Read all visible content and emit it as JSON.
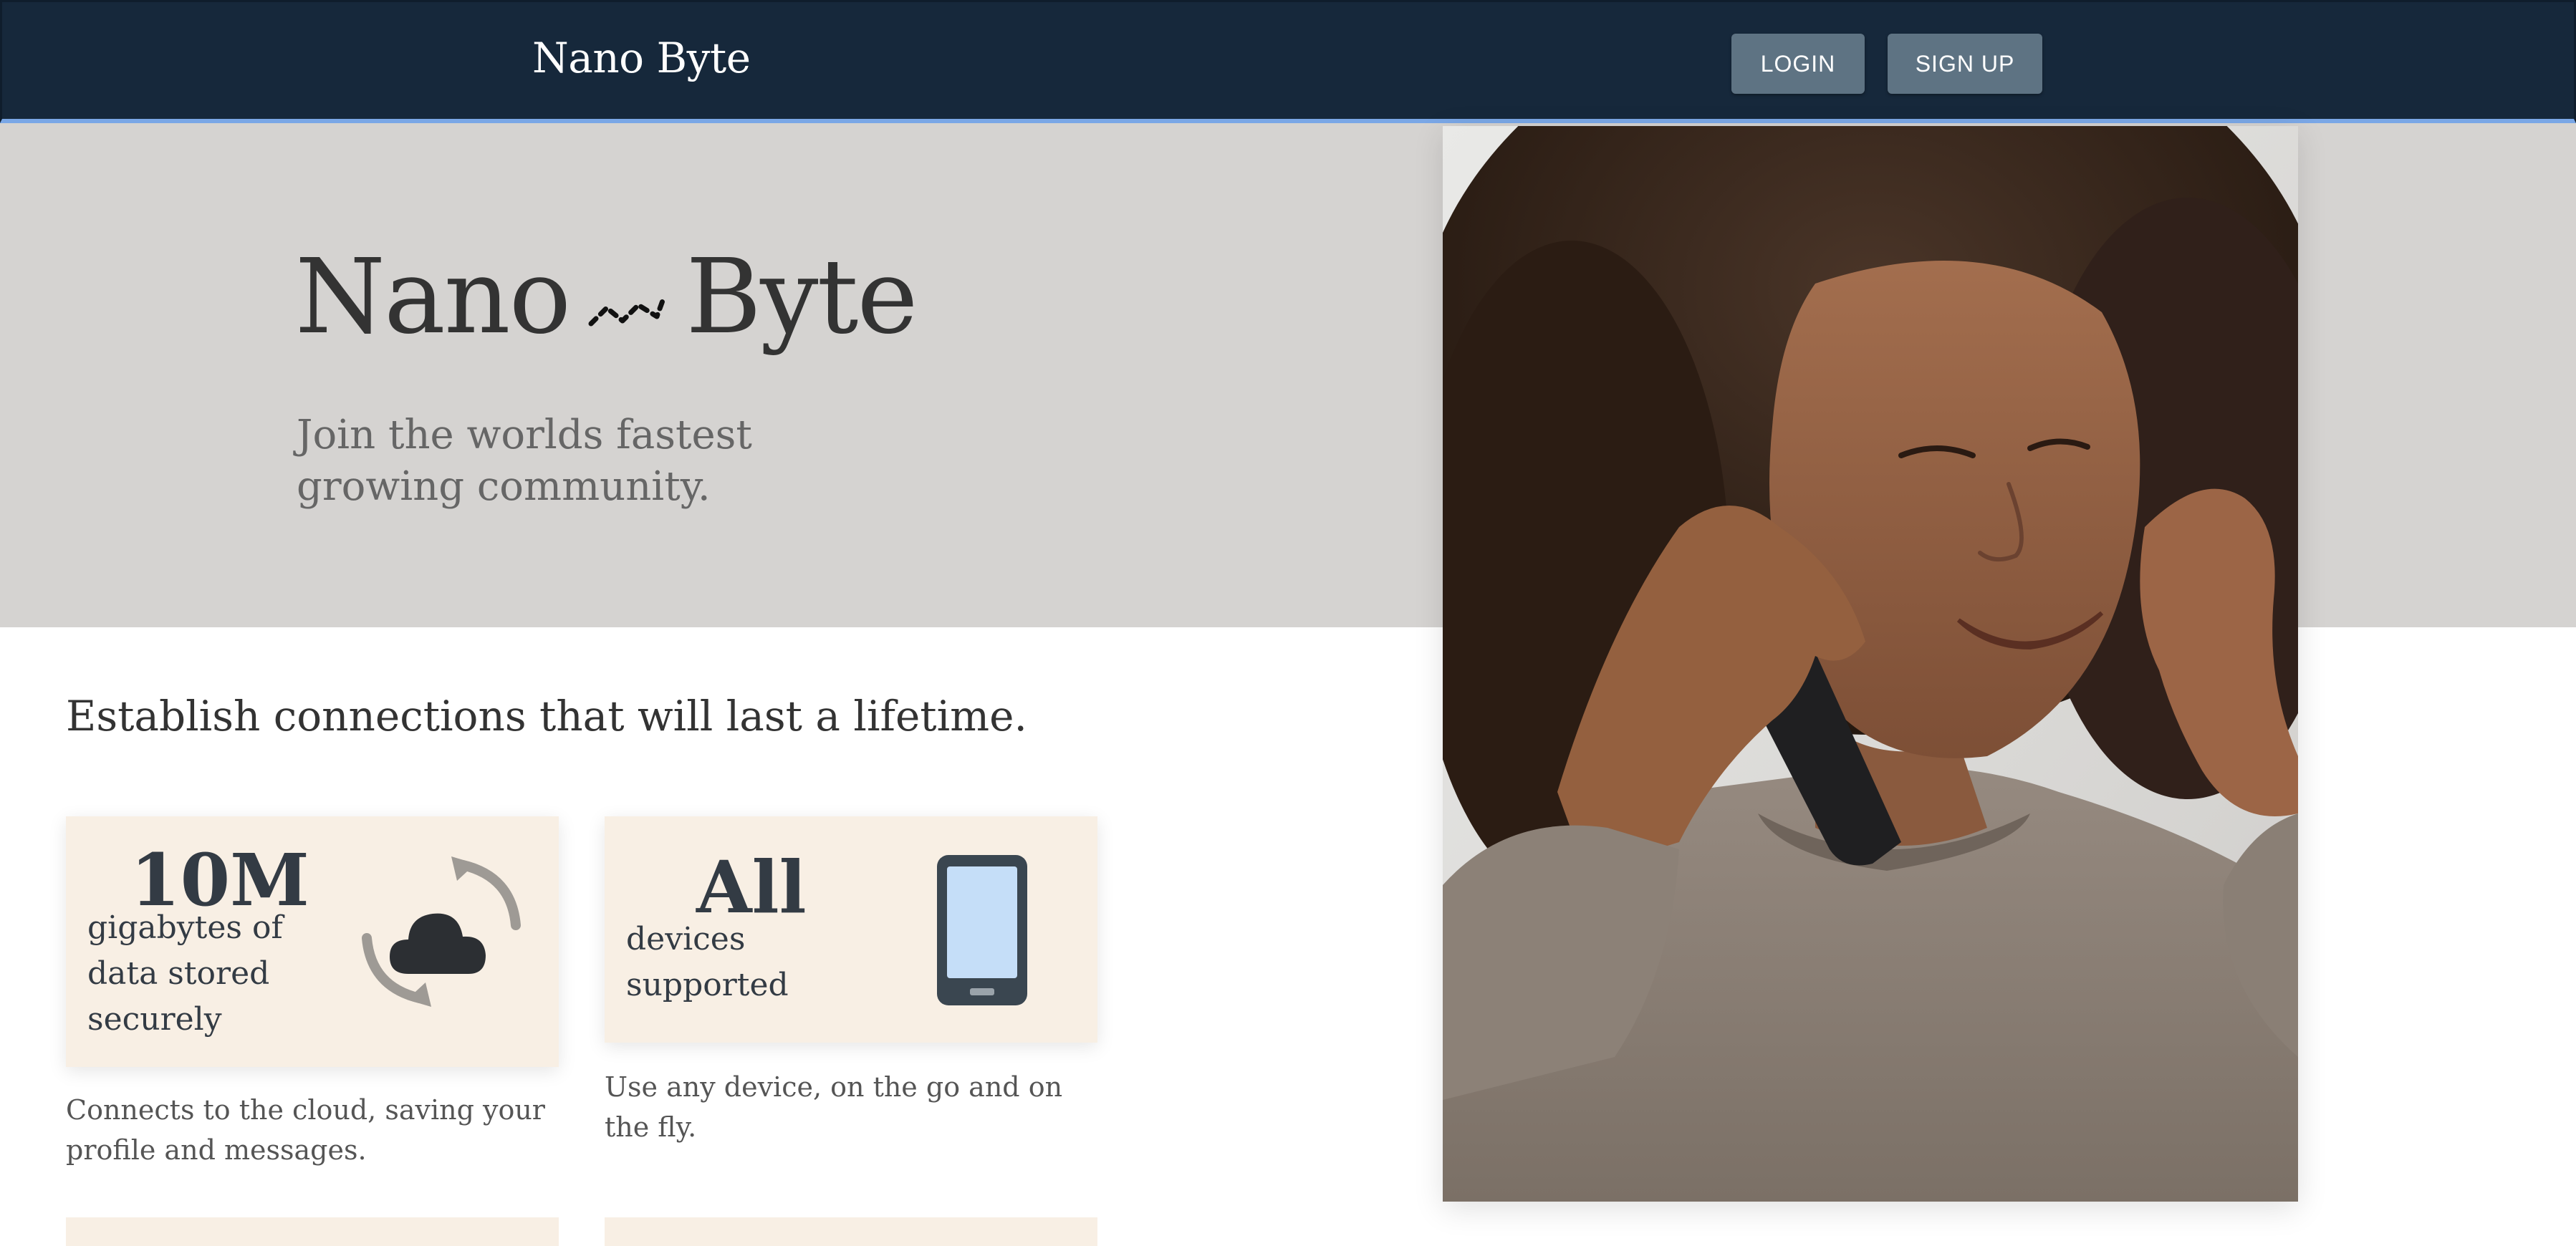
{
  "nav": {
    "brand": "Nano Byte",
    "login_label": "LOGIN",
    "signup_label": "SIGN UP",
    "background": "#16283b",
    "button_color": "#5e7383"
  },
  "hero": {
    "title_left": "Nano",
    "title_right": "Byte",
    "logo_icon": "wave-dots-icon",
    "subtitle": "Join the worlds fastest growing community.",
    "background": "#d5d3d1"
  },
  "photo": {
    "description_icon": "woman-on-phone-photo"
  },
  "content": {
    "tagline": "Establish connections that will last a lifetime.",
    "cards": [
      {
        "stat": "10M",
        "label": "gigabytes of data stored securely",
        "icon": "cloud-sync-icon",
        "description": "Connects to the cloud, saving your profile and messages."
      },
      {
        "stat": "All",
        "label": "devices supported",
        "icon": "smartphone-icon",
        "description": "Use any device, on the go and on the fly."
      }
    ],
    "card_color": "#f8efe4"
  }
}
